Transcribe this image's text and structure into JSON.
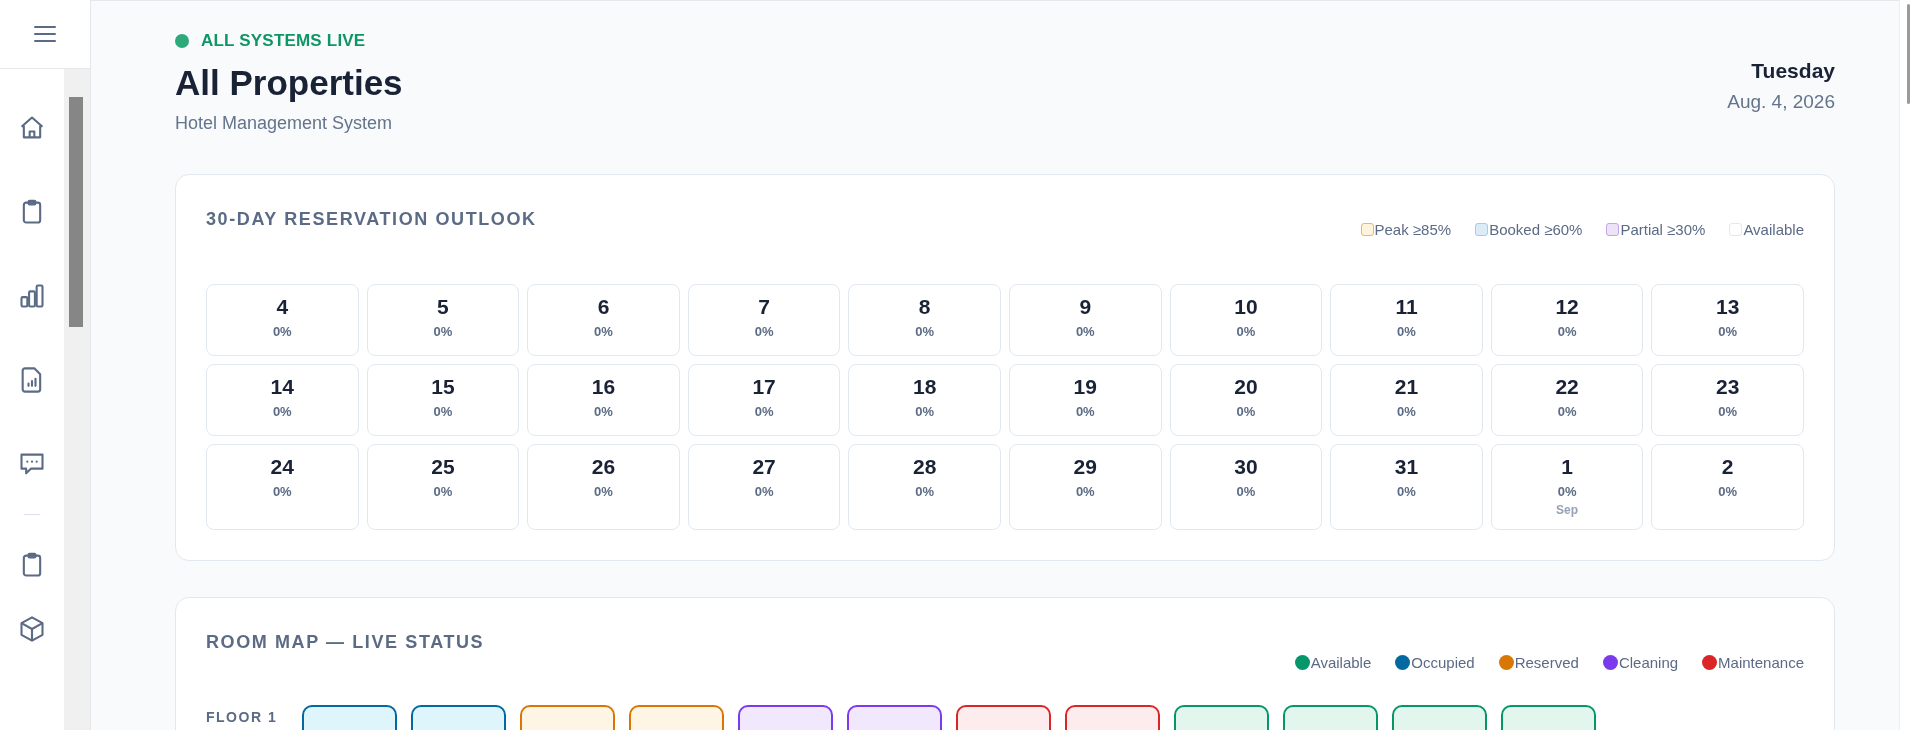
{
  "sidebar": {
    "items": [
      {
        "kind": "home"
      },
      {
        "kind": "clipboard"
      },
      {
        "kind": "bars"
      },
      {
        "kind": "report"
      },
      {
        "kind": "chat"
      },
      {
        "kind": "divider"
      },
      {
        "kind": "clipboard"
      },
      {
        "kind": "cube"
      }
    ]
  },
  "header": {
    "status": "ALL SYSTEMS LIVE",
    "title": "All Properties",
    "subtitle": "Hotel Management System",
    "weekday": "Tuesday",
    "date": "Aug. 4, 2026"
  },
  "outlook": {
    "title": "30-DAY RESERVATION OUTLOOK",
    "legend": [
      {
        "label": "Peak ≥85%",
        "kind": "peak"
      },
      {
        "label": "Booked ≥60%",
        "kind": "booked"
      },
      {
        "label": "Partial ≥30%",
        "kind": "partial"
      },
      {
        "label": "Available",
        "kind": "available"
      }
    ],
    "days": [
      {
        "day": "4",
        "occupancy": "0%",
        "kind": "available"
      },
      {
        "day": "5",
        "occupancy": "0%",
        "kind": "available"
      },
      {
        "day": "6",
        "occupancy": "0%",
        "kind": "available"
      },
      {
        "day": "7",
        "occupancy": "0%",
        "kind": "available"
      },
      {
        "day": "8",
        "occupancy": "0%",
        "kind": "available"
      },
      {
        "day": "9",
        "occupancy": "0%",
        "kind": "available"
      },
      {
        "day": "10",
        "occupancy": "0%",
        "kind": "available"
      },
      {
        "day": "11",
        "occupancy": "0%",
        "kind": "available"
      },
      {
        "day": "12",
        "occupancy": "0%",
        "kind": "available"
      },
      {
        "day": "13",
        "occupancy": "0%",
        "kind": "available"
      },
      {
        "day": "14",
        "occupancy": "0%",
        "kind": "available"
      },
      {
        "day": "15",
        "occupancy": "0%",
        "kind": "available"
      },
      {
        "day": "16",
        "occupancy": "0%",
        "kind": "available"
      },
      {
        "day": "17",
        "occupancy": "0%",
        "kind": "available"
      },
      {
        "day": "18",
        "occupancy": "0%",
        "kind": "available"
      },
      {
        "day": "19",
        "occupancy": "0%",
        "kind": "available"
      },
      {
        "day": "20",
        "occupancy": "0%",
        "kind": "available"
      },
      {
        "day": "21",
        "occupancy": "0%",
        "kind": "available"
      },
      {
        "day": "22",
        "occupancy": "0%",
        "kind": "available"
      },
      {
        "day": "23",
        "occupancy": "0%",
        "kind": "available"
      },
      {
        "day": "24",
        "occupancy": "0%",
        "kind": "available"
      },
      {
        "day": "25",
        "occupancy": "0%",
        "kind": "available"
      },
      {
        "day": "26",
        "occupancy": "0%",
        "kind": "available"
      },
      {
        "day": "27",
        "occupancy": "0%",
        "kind": "available"
      },
      {
        "day": "28",
        "occupancy": "0%",
        "kind": "available"
      },
      {
        "day": "29",
        "occupancy": "0%",
        "kind": "available"
      },
      {
        "day": "30",
        "occupancy": "0%",
        "kind": "available"
      },
      {
        "day": "31",
        "occupancy": "0%",
        "kind": "available"
      },
      {
        "day": "1",
        "occupancy": "0%",
        "kind": "available",
        "month": "Sep"
      },
      {
        "day": "2",
        "occupancy": "0%",
        "kind": "available"
      }
    ]
  },
  "room_map": {
    "title": "ROOM MAP — LIVE STATUS",
    "legend": [
      {
        "label": "Available",
        "color": "#059669"
      },
      {
        "label": "Occupied",
        "color": "#0369a1"
      },
      {
        "label": "Reserved",
        "color": "#d97706"
      },
      {
        "label": "Cleaning",
        "color": "#7c3aed"
      },
      {
        "label": "Maintenance",
        "color": "#dc2626"
      }
    ],
    "floors": [
      {
        "label": "FLOOR 1",
        "rooms": [
          {
            "kind": "occupied"
          },
          {
            "kind": "occupied"
          },
          {
            "kind": "reserved"
          },
          {
            "kind": "reserved"
          },
          {
            "kind": "cleaning"
          },
          {
            "kind": "cleaning"
          },
          {
            "kind": "maintenance"
          },
          {
            "kind": "maintenance"
          },
          {
            "kind": "available"
          },
          {
            "kind": "available"
          },
          {
            "kind": "available"
          },
          {
            "kind": "available"
          }
        ]
      }
    ]
  }
}
